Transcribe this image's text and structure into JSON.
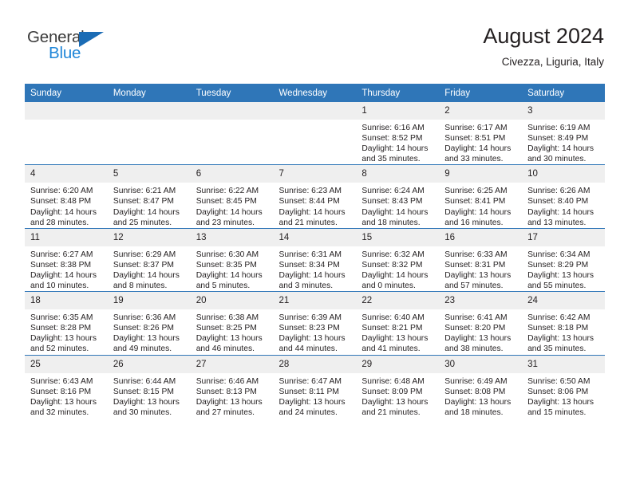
{
  "brand": {
    "name_part1": "General",
    "name_part2": "Blue",
    "triangle_color": "#1b6cb5",
    "blue_color": "#1f86d8"
  },
  "header": {
    "title": "August 2024",
    "subtitle": "Civezza, Liguria, Italy"
  },
  "theme": {
    "header_blue": "#2f76b8",
    "daynum_bg": "#efefef",
    "text": "#231f20"
  },
  "weekday_headers": [
    "Sunday",
    "Monday",
    "Tuesday",
    "Wednesday",
    "Thursday",
    "Friday",
    "Saturday"
  ],
  "labels": {
    "sunrise_prefix": "Sunrise:",
    "sunset_prefix": "Sunset:",
    "daylight_prefix": "Daylight:"
  },
  "weeks": [
    [
      {
        "day": "",
        "sunrise": "",
        "sunset": "",
        "daylight": ""
      },
      {
        "day": "",
        "sunrise": "",
        "sunset": "",
        "daylight": ""
      },
      {
        "day": "",
        "sunrise": "",
        "sunset": "",
        "daylight": ""
      },
      {
        "day": "",
        "sunrise": "",
        "sunset": "",
        "daylight": ""
      },
      {
        "day": "1",
        "sunrise": "Sunrise: 6:16 AM",
        "sunset": "Sunset: 8:52 PM",
        "daylight": "Daylight: 14 hours and 35 minutes."
      },
      {
        "day": "2",
        "sunrise": "Sunrise: 6:17 AM",
        "sunset": "Sunset: 8:51 PM",
        "daylight": "Daylight: 14 hours and 33 minutes."
      },
      {
        "day": "3",
        "sunrise": "Sunrise: 6:19 AM",
        "sunset": "Sunset: 8:49 PM",
        "daylight": "Daylight: 14 hours and 30 minutes."
      }
    ],
    [
      {
        "day": "4",
        "sunrise": "Sunrise: 6:20 AM",
        "sunset": "Sunset: 8:48 PM",
        "daylight": "Daylight: 14 hours and 28 minutes."
      },
      {
        "day": "5",
        "sunrise": "Sunrise: 6:21 AM",
        "sunset": "Sunset: 8:47 PM",
        "daylight": "Daylight: 14 hours and 25 minutes."
      },
      {
        "day": "6",
        "sunrise": "Sunrise: 6:22 AM",
        "sunset": "Sunset: 8:45 PM",
        "daylight": "Daylight: 14 hours and 23 minutes."
      },
      {
        "day": "7",
        "sunrise": "Sunrise: 6:23 AM",
        "sunset": "Sunset: 8:44 PM",
        "daylight": "Daylight: 14 hours and 21 minutes."
      },
      {
        "day": "8",
        "sunrise": "Sunrise: 6:24 AM",
        "sunset": "Sunset: 8:43 PM",
        "daylight": "Daylight: 14 hours and 18 minutes."
      },
      {
        "day": "9",
        "sunrise": "Sunrise: 6:25 AM",
        "sunset": "Sunset: 8:41 PM",
        "daylight": "Daylight: 14 hours and 16 minutes."
      },
      {
        "day": "10",
        "sunrise": "Sunrise: 6:26 AM",
        "sunset": "Sunset: 8:40 PM",
        "daylight": "Daylight: 14 hours and 13 minutes."
      }
    ],
    [
      {
        "day": "11",
        "sunrise": "Sunrise: 6:27 AM",
        "sunset": "Sunset: 8:38 PM",
        "daylight": "Daylight: 14 hours and 10 minutes."
      },
      {
        "day": "12",
        "sunrise": "Sunrise: 6:29 AM",
        "sunset": "Sunset: 8:37 PM",
        "daylight": "Daylight: 14 hours and 8 minutes."
      },
      {
        "day": "13",
        "sunrise": "Sunrise: 6:30 AM",
        "sunset": "Sunset: 8:35 PM",
        "daylight": "Daylight: 14 hours and 5 minutes."
      },
      {
        "day": "14",
        "sunrise": "Sunrise: 6:31 AM",
        "sunset": "Sunset: 8:34 PM",
        "daylight": "Daylight: 14 hours and 3 minutes."
      },
      {
        "day": "15",
        "sunrise": "Sunrise: 6:32 AM",
        "sunset": "Sunset: 8:32 PM",
        "daylight": "Daylight: 14 hours and 0 minutes."
      },
      {
        "day": "16",
        "sunrise": "Sunrise: 6:33 AM",
        "sunset": "Sunset: 8:31 PM",
        "daylight": "Daylight: 13 hours and 57 minutes."
      },
      {
        "day": "17",
        "sunrise": "Sunrise: 6:34 AM",
        "sunset": "Sunset: 8:29 PM",
        "daylight": "Daylight: 13 hours and 55 minutes."
      }
    ],
    [
      {
        "day": "18",
        "sunrise": "Sunrise: 6:35 AM",
        "sunset": "Sunset: 8:28 PM",
        "daylight": "Daylight: 13 hours and 52 minutes."
      },
      {
        "day": "19",
        "sunrise": "Sunrise: 6:36 AM",
        "sunset": "Sunset: 8:26 PM",
        "daylight": "Daylight: 13 hours and 49 minutes."
      },
      {
        "day": "20",
        "sunrise": "Sunrise: 6:38 AM",
        "sunset": "Sunset: 8:25 PM",
        "daylight": "Daylight: 13 hours and 46 minutes."
      },
      {
        "day": "21",
        "sunrise": "Sunrise: 6:39 AM",
        "sunset": "Sunset: 8:23 PM",
        "daylight": "Daylight: 13 hours and 44 minutes."
      },
      {
        "day": "22",
        "sunrise": "Sunrise: 6:40 AM",
        "sunset": "Sunset: 8:21 PM",
        "daylight": "Daylight: 13 hours and 41 minutes."
      },
      {
        "day": "23",
        "sunrise": "Sunrise: 6:41 AM",
        "sunset": "Sunset: 8:20 PM",
        "daylight": "Daylight: 13 hours and 38 minutes."
      },
      {
        "day": "24",
        "sunrise": "Sunrise: 6:42 AM",
        "sunset": "Sunset: 8:18 PM",
        "daylight": "Daylight: 13 hours and 35 minutes."
      }
    ],
    [
      {
        "day": "25",
        "sunrise": "Sunrise: 6:43 AM",
        "sunset": "Sunset: 8:16 PM",
        "daylight": "Daylight: 13 hours and 32 minutes."
      },
      {
        "day": "26",
        "sunrise": "Sunrise: 6:44 AM",
        "sunset": "Sunset: 8:15 PM",
        "daylight": "Daylight: 13 hours and 30 minutes."
      },
      {
        "day": "27",
        "sunrise": "Sunrise: 6:46 AM",
        "sunset": "Sunset: 8:13 PM",
        "daylight": "Daylight: 13 hours and 27 minutes."
      },
      {
        "day": "28",
        "sunrise": "Sunrise: 6:47 AM",
        "sunset": "Sunset: 8:11 PM",
        "daylight": "Daylight: 13 hours and 24 minutes."
      },
      {
        "day": "29",
        "sunrise": "Sunrise: 6:48 AM",
        "sunset": "Sunset: 8:09 PM",
        "daylight": "Daylight: 13 hours and 21 minutes."
      },
      {
        "day": "30",
        "sunrise": "Sunrise: 6:49 AM",
        "sunset": "Sunset: 8:08 PM",
        "daylight": "Daylight: 13 hours and 18 minutes."
      },
      {
        "day": "31",
        "sunrise": "Sunrise: 6:50 AM",
        "sunset": "Sunset: 8:06 PM",
        "daylight": "Daylight: 13 hours and 15 minutes."
      }
    ]
  ]
}
